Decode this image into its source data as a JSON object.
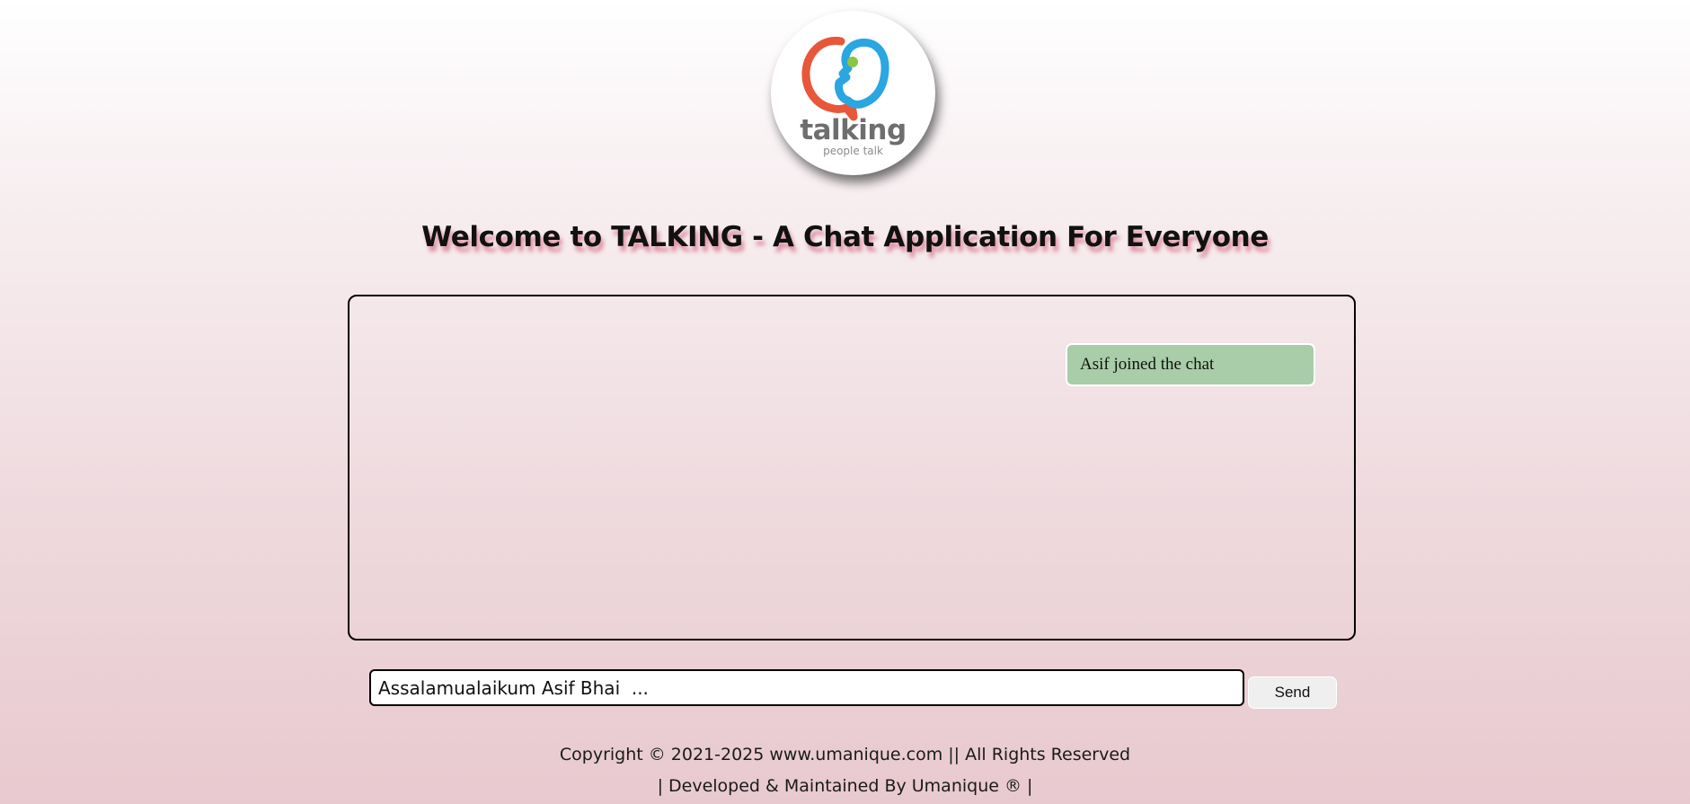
{
  "app": {
    "logo": {
      "wordmark": "talking",
      "tagline": "people talk",
      "colors": {
        "red": "#e8573a",
        "blue": "#2aa6e0",
        "green": "#8cc63f",
        "gray": "#6e6e6e"
      }
    },
    "title": "Welcome to TALKING - A Chat Application For Everyone"
  },
  "chat": {
    "messages": [
      {
        "type": "system",
        "text": "Asif joined the chat",
        "color": "#a8cda8"
      }
    ]
  },
  "composer": {
    "value": "Assalamualaikum Asif Bhai  ...",
    "send_label": "Send"
  },
  "footer": {
    "copyright": "Copyright © 2021-2025 www.umanique.com || All Rights Reserved",
    "developer": "| Developed & Maintained By Umanique ® |"
  }
}
